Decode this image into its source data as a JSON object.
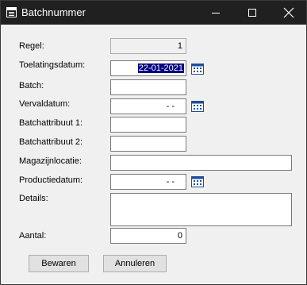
{
  "window": {
    "title": "Batchnummer"
  },
  "form": {
    "regel": {
      "label": "Regel:",
      "value": "1"
    },
    "toelatingsdatum": {
      "label": "Toelatingsdatum:",
      "value": "22-01-2021"
    },
    "batch": {
      "label": "Batch:",
      "value": ""
    },
    "vervaldatum": {
      "label": "Vervaldatum:",
      "value": "- -"
    },
    "batchattribuut1": {
      "label": "Batchattribuut 1:",
      "value": ""
    },
    "batchattribuut2": {
      "label": "Batchattribuut 2:",
      "value": ""
    },
    "magazijnlocatie": {
      "label": "Magazijnlocatie:",
      "value": ""
    },
    "productiedatum": {
      "label": "Productiedatum:",
      "value": "- -"
    },
    "details": {
      "label": "Details:",
      "value": ""
    },
    "aantal": {
      "label": "Aantal:",
      "value": "0"
    }
  },
  "buttons": {
    "bewaren": "Bewaren",
    "annuleren": "Annuleren"
  },
  "colors": {
    "titlebar": "#202020",
    "selection": "#000080",
    "calendar_icon": "#1f4e99"
  },
  "icons": {
    "app": "list-window-icon",
    "calendar": "calendar-icon",
    "minimize": "minimize-icon",
    "maximize": "maximize-icon",
    "close": "close-icon"
  }
}
